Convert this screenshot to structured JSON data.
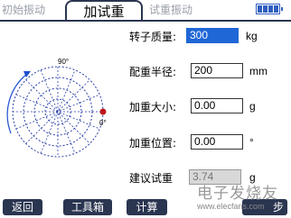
{
  "tabs": [
    {
      "label": "初始振动",
      "active": false
    },
    {
      "label": "加试重",
      "active": true
    },
    {
      "label": "试重振动",
      "active": false
    }
  ],
  "battery": {
    "level": 1.0,
    "cells": 4
  },
  "polar": {
    "angle_90": "90°",
    "angle_0": "0°"
  },
  "form": {
    "rotor_mass": {
      "label": "转子质量:",
      "value": "300",
      "unit": "kg"
    },
    "radius": {
      "label": "配重半径:",
      "value": "200",
      "unit": "mm"
    },
    "weight_size": {
      "label": "加重大小:",
      "value": "0.00",
      "unit": "g"
    },
    "weight_position": {
      "label": "加重位置:",
      "value": "0.00",
      "unit": "°"
    },
    "suggested": {
      "label": "建议试重",
      "value": "3.74",
      "unit": "g"
    }
  },
  "buttons": {
    "back": "返回",
    "toolbox": "工具箱",
    "calc": "计算",
    "next": "步"
  },
  "watermark": {
    "title": "电子发烧友",
    "url": "www.elecfans.com"
  },
  "colors": {
    "accent": "#1f66d6",
    "nav": "#2a3550",
    "marker": "#c0141c"
  }
}
